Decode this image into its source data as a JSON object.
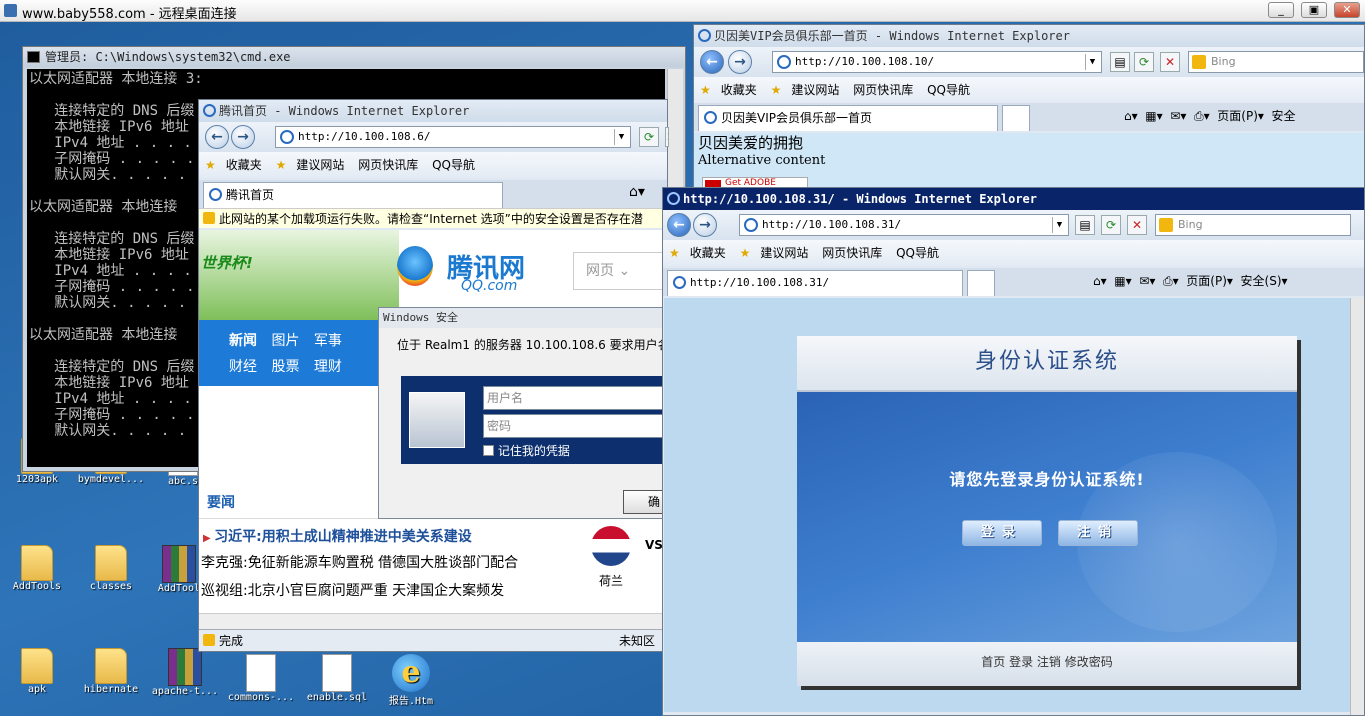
{
  "rdp": {
    "title": "www.baby558.com - 远程桌面连接"
  },
  "desktop_icons": [
    {
      "label": "1203apk"
    },
    {
      "label": "bymdevel..."
    },
    {
      "label": "abc.s"
    },
    {
      "label": "AddTools"
    },
    {
      "label": "classes"
    },
    {
      "label": "AddTool"
    },
    {
      "label": "apk"
    },
    {
      "label": "hibernate"
    },
    {
      "label": "apache-t..."
    },
    {
      "label": "commons-..."
    },
    {
      "label": "enable.sql"
    },
    {
      "label": "报告.Htm"
    }
  ],
  "cmd": {
    "title": "管理员: C:\\Windows\\system32\\cmd.exe",
    "lines": [
      "以太网适配器 本地连接 3:",
      "",
      "   连接特定的 DNS 后缀",
      "   本地链接 IPv6 地址",
      "   IPv4 地址 . . . .",
      "   子网掩码 . . . . .",
      "   默认网关. . . . .",
      "",
      "以太网适配器 本地连接",
      "",
      "   连接特定的 DNS 后缀",
      "   本地链接 IPv6 地址",
      "   IPv4 地址 . . . .",
      "   子网掩码 . . . . .",
      "   默认网关. . . . .",
      "",
      "以太网适配器 本地连接",
      "",
      "   连接特定的 DNS 后缀",
      "   本地链接 IPv6 地址",
      "   IPv4 地址 . . . .",
      "   子网掩码 . . . . .",
      "   默认网关. . . . ."
    ]
  },
  "common": {
    "favorites": "收藏夹",
    "suggested": "建议网站",
    "webslice": "网页快讯库",
    "qqnav": "QQ导航",
    "page_menu": "页面(P)",
    "safety_menu": "安全(S)",
    "safety_short": "安全",
    "bing": "Bing"
  },
  "ie_beiyinmei": {
    "title": "贝因美VIP会员俱乐部一首页 - Windows Internet Explorer",
    "url": "http://10.100.108.10/",
    "tab": "贝因美VIP会员俱乐部一首页",
    "content_heading": "贝因美爱的拥抱",
    "alt_text": "Alternative content",
    "get_flash": "Get ADOBE"
  },
  "ie_tencent": {
    "title": "腾讯首页 - Windows Internet Explorer",
    "url": "http://10.100.108.6/",
    "tab": "腾讯首页",
    "infobar": "此网站的某个加载项运行失败。请检查“Internet 选项”中的安全设置是否存在潜",
    "worldcup": "世界杯!",
    "logo_cn": "腾讯网",
    "logo_en": "QQ.com",
    "search_type": "网页",
    "nav_row1": [
      "新闻",
      "图片",
      "军事"
    ],
    "nav_row2": [
      "财经",
      "股票",
      "理财"
    ],
    "section": "要闻",
    "headline": "习近平:用积土成山精神推进中美关系建设",
    "news": [
      "李克强:免征新能源车购置税 借德国大胜谈部门配合",
      "巡视组:北京小官巨腐问题严重 天津国企大案频发"
    ],
    "flag_label": "荷兰",
    "vs": "VS",
    "status": "完成",
    "zone": "未知区"
  },
  "dialog": {
    "title": "Windows 安全",
    "message": "位于 Realm1 的服务器 10.100.108.6 要求用户名",
    "username_placeholder": "用户名",
    "password_placeholder": "密码",
    "remember": "记住我的凭据",
    "ok": "确"
  },
  "ie_auth": {
    "title": "http://10.100.108.31/ - Windows Internet Explorer",
    "url": "http://10.100.108.31/",
    "tab": "http://10.100.108.31/",
    "header": "身份认证系统",
    "prompt": "请您先登录身份认证系统!",
    "login_btn": "登录",
    "logout_btn": "注销",
    "footer": "首页 登录 注销 修改密码"
  }
}
